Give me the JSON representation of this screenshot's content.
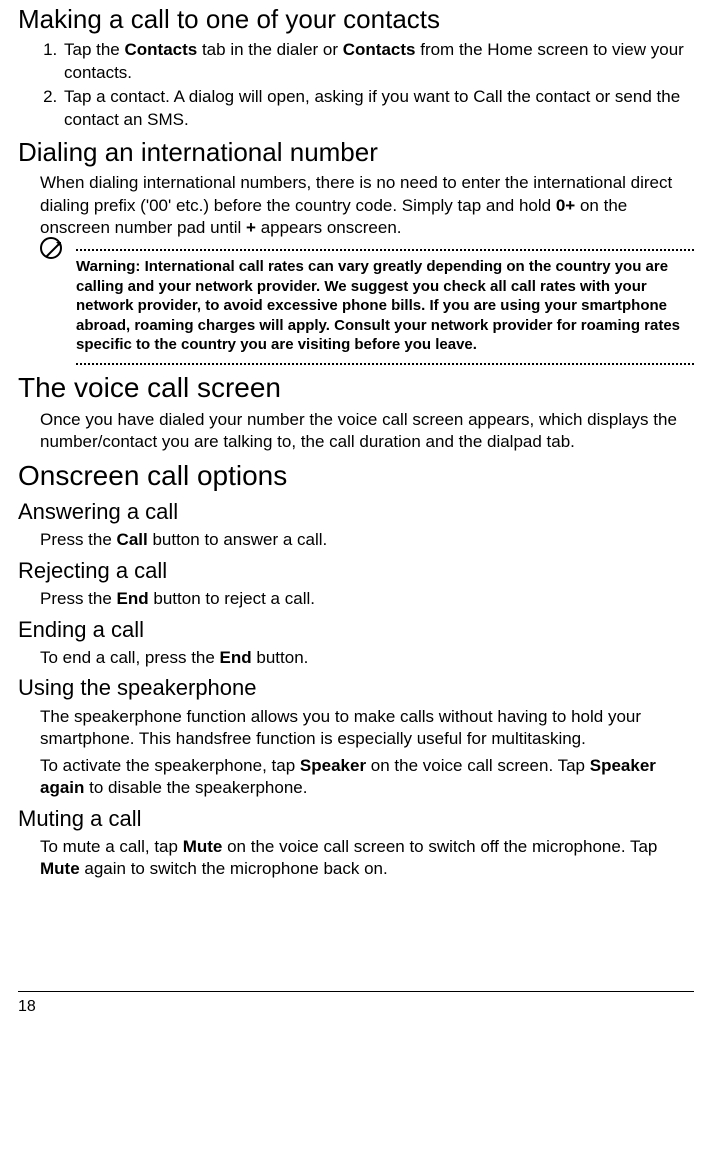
{
  "sections": {
    "making_call": {
      "title": "Making a call to one of your contacts",
      "step1_a": "Tap the ",
      "step1_b": "Contacts",
      "step1_c": " tab in the dialer or ",
      "step1_d": "Contacts",
      "step1_e": " from the Home screen to view your contacts.",
      "step2": "Tap a contact. A dialog will open, asking if you want to Call the contact or send the contact an SMS."
    },
    "intl": {
      "title": "Dialing an international number",
      "p1_a": "When dialing international numbers, there is no need to enter the international direct dialing prefix ('00' etc.) before the country code. Simply tap and hold ",
      "p1_b": "0+",
      "p1_c": " on the onscreen number pad until ",
      "p1_d": "+",
      "p1_e": " appears onscreen.",
      "warning": "Warning: International call rates can vary greatly depending on the country you are calling and your network provider. We suggest you check all call rates with your network provider, to avoid excessive phone bills. If you are using your smartphone abroad, roaming charges will apply. Consult your network provider for roaming rates specific to the country you are visiting before you leave."
    },
    "voice_screen": {
      "title": "The voice call screen",
      "p1": "Once you have dialed your number the voice call screen appears, which displays the number/contact you are talking to, the call duration and the dialpad tab."
    },
    "onscreen": {
      "title": "Onscreen call options"
    },
    "answer": {
      "title": "Answering a call",
      "p_a": "Press the ",
      "p_b": "Call",
      "p_c": " button to answer a call."
    },
    "reject": {
      "title": "Rejecting a call",
      "p_a": "Press the ",
      "p_b": "End",
      "p_c": " button to reject a call."
    },
    "end": {
      "title": "Ending a call",
      "p_a": "To end a call, press the ",
      "p_b": "End",
      "p_c": " button."
    },
    "speaker": {
      "title": "Using the speakerphone",
      "p1": "The speakerphone function allows you to make calls without having to hold your smartphone. This handsfree function is especially useful for multitasking.",
      "p2_a": "To activate the speakerphone, tap ",
      "p2_b": "Speaker",
      "p2_c": " on the voice call screen. Tap ",
      "p2_d": "Speaker again",
      "p2_e": " to disable the speakerphone."
    },
    "mute": {
      "title": "Muting a call",
      "p_a": "To mute a call, tap ",
      "p_b": "Mute",
      "p_c": " on the voice call screen to switch off the microphone. Tap ",
      "p_d": "Mute",
      "p_e": " again to switch the microphone back on."
    }
  },
  "page_number": "18"
}
